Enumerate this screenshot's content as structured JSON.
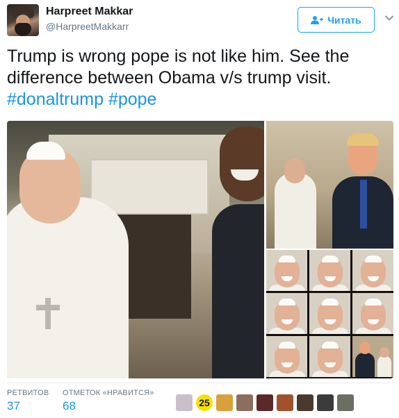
{
  "tweet": {
    "author": {
      "display_name": "Harpreet Makkar",
      "screen_name": "@HarpreetMakkarr"
    },
    "follow_label": "Читать",
    "text_main": "Trump is wrong pope is not like him. See the difference between Obama v/s trump visit.",
    "hashtags": [
      "#donaltrump",
      "#pope"
    ]
  },
  "stats": {
    "retweets_label": "РЕТВИТОВ",
    "retweets_count": "37",
    "likes_label": "ОТМЕТОК «НРАВИТСЯ»",
    "likes_count": "68"
  },
  "likers": {
    "badge_text": "25",
    "avatar_colors": [
      "#c9bfc8",
      "#f6e100",
      "#d9a13a",
      "#8b6e5c",
      "#5a2a2a",
      "#a0522d",
      "#4a3a2e",
      "#3b3b3b",
      "#6b6f63"
    ]
  },
  "colors": {
    "accent": "#1da1f2",
    "link": "#1b95e0",
    "muted": "#657786",
    "text": "#14171a"
  },
  "icons": {
    "follow": "add-user-icon",
    "menu": "chevron-down-icon"
  }
}
